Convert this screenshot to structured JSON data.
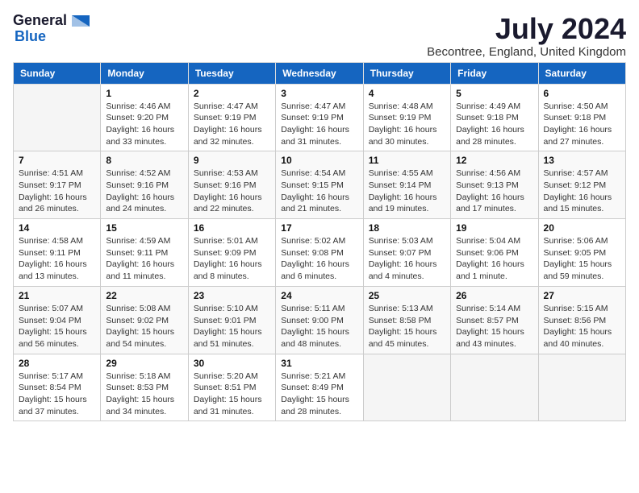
{
  "logo": {
    "general": "General",
    "blue": "Blue"
  },
  "title": "July 2024",
  "location": "Becontree, England, United Kingdom",
  "days_header": [
    "Sunday",
    "Monday",
    "Tuesday",
    "Wednesday",
    "Thursday",
    "Friday",
    "Saturday"
  ],
  "weeks": [
    [
      {
        "day": "",
        "info": ""
      },
      {
        "day": "1",
        "info": "Sunrise: 4:46 AM\nSunset: 9:20 PM\nDaylight: 16 hours\nand 33 minutes."
      },
      {
        "day": "2",
        "info": "Sunrise: 4:47 AM\nSunset: 9:19 PM\nDaylight: 16 hours\nand 32 minutes."
      },
      {
        "day": "3",
        "info": "Sunrise: 4:47 AM\nSunset: 9:19 PM\nDaylight: 16 hours\nand 31 minutes."
      },
      {
        "day": "4",
        "info": "Sunrise: 4:48 AM\nSunset: 9:19 PM\nDaylight: 16 hours\nand 30 minutes."
      },
      {
        "day": "5",
        "info": "Sunrise: 4:49 AM\nSunset: 9:18 PM\nDaylight: 16 hours\nand 28 minutes."
      },
      {
        "day": "6",
        "info": "Sunrise: 4:50 AM\nSunset: 9:18 PM\nDaylight: 16 hours\nand 27 minutes."
      }
    ],
    [
      {
        "day": "7",
        "info": "Sunrise: 4:51 AM\nSunset: 9:17 PM\nDaylight: 16 hours\nand 26 minutes."
      },
      {
        "day": "8",
        "info": "Sunrise: 4:52 AM\nSunset: 9:16 PM\nDaylight: 16 hours\nand 24 minutes."
      },
      {
        "day": "9",
        "info": "Sunrise: 4:53 AM\nSunset: 9:16 PM\nDaylight: 16 hours\nand 22 minutes."
      },
      {
        "day": "10",
        "info": "Sunrise: 4:54 AM\nSunset: 9:15 PM\nDaylight: 16 hours\nand 21 minutes."
      },
      {
        "day": "11",
        "info": "Sunrise: 4:55 AM\nSunset: 9:14 PM\nDaylight: 16 hours\nand 19 minutes."
      },
      {
        "day": "12",
        "info": "Sunrise: 4:56 AM\nSunset: 9:13 PM\nDaylight: 16 hours\nand 17 minutes."
      },
      {
        "day": "13",
        "info": "Sunrise: 4:57 AM\nSunset: 9:12 PM\nDaylight: 16 hours\nand 15 minutes."
      }
    ],
    [
      {
        "day": "14",
        "info": "Sunrise: 4:58 AM\nSunset: 9:11 PM\nDaylight: 16 hours\nand 13 minutes."
      },
      {
        "day": "15",
        "info": "Sunrise: 4:59 AM\nSunset: 9:11 PM\nDaylight: 16 hours\nand 11 minutes."
      },
      {
        "day": "16",
        "info": "Sunrise: 5:01 AM\nSunset: 9:09 PM\nDaylight: 16 hours\nand 8 minutes."
      },
      {
        "day": "17",
        "info": "Sunrise: 5:02 AM\nSunset: 9:08 PM\nDaylight: 16 hours\nand 6 minutes."
      },
      {
        "day": "18",
        "info": "Sunrise: 5:03 AM\nSunset: 9:07 PM\nDaylight: 16 hours\nand 4 minutes."
      },
      {
        "day": "19",
        "info": "Sunrise: 5:04 AM\nSunset: 9:06 PM\nDaylight: 16 hours\nand 1 minute."
      },
      {
        "day": "20",
        "info": "Sunrise: 5:06 AM\nSunset: 9:05 PM\nDaylight: 15 hours\nand 59 minutes."
      }
    ],
    [
      {
        "day": "21",
        "info": "Sunrise: 5:07 AM\nSunset: 9:04 PM\nDaylight: 15 hours\nand 56 minutes."
      },
      {
        "day": "22",
        "info": "Sunrise: 5:08 AM\nSunset: 9:02 PM\nDaylight: 15 hours\nand 54 minutes."
      },
      {
        "day": "23",
        "info": "Sunrise: 5:10 AM\nSunset: 9:01 PM\nDaylight: 15 hours\nand 51 minutes."
      },
      {
        "day": "24",
        "info": "Sunrise: 5:11 AM\nSunset: 9:00 PM\nDaylight: 15 hours\nand 48 minutes."
      },
      {
        "day": "25",
        "info": "Sunrise: 5:13 AM\nSunset: 8:58 PM\nDaylight: 15 hours\nand 45 minutes."
      },
      {
        "day": "26",
        "info": "Sunrise: 5:14 AM\nSunset: 8:57 PM\nDaylight: 15 hours\nand 43 minutes."
      },
      {
        "day": "27",
        "info": "Sunrise: 5:15 AM\nSunset: 8:56 PM\nDaylight: 15 hours\nand 40 minutes."
      }
    ],
    [
      {
        "day": "28",
        "info": "Sunrise: 5:17 AM\nSunset: 8:54 PM\nDaylight: 15 hours\nand 37 minutes."
      },
      {
        "day": "29",
        "info": "Sunrise: 5:18 AM\nSunset: 8:53 PM\nDaylight: 15 hours\nand 34 minutes."
      },
      {
        "day": "30",
        "info": "Sunrise: 5:20 AM\nSunset: 8:51 PM\nDaylight: 15 hours\nand 31 minutes."
      },
      {
        "day": "31",
        "info": "Sunrise: 5:21 AM\nSunset: 8:49 PM\nDaylight: 15 hours\nand 28 minutes."
      },
      {
        "day": "",
        "info": ""
      },
      {
        "day": "",
        "info": ""
      },
      {
        "day": "",
        "info": ""
      }
    ]
  ]
}
